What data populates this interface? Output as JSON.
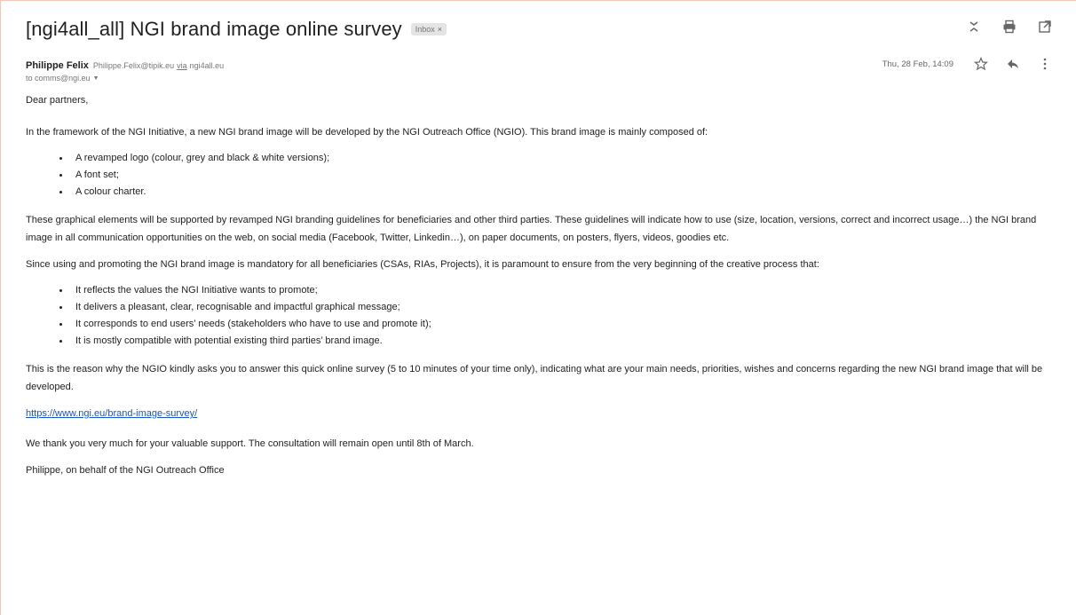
{
  "header": {
    "subject": "[ngi4all_all] NGI brand image online survey",
    "label": "Inbox",
    "label_close": "×",
    "icons": [
      "expand-collapse-icon",
      "print-icon",
      "open-in-new-window-icon"
    ]
  },
  "message": {
    "sender_name": "Philippe Felix",
    "sender_email": "Philippe.Felix@tipik.eu",
    "via": "via",
    "list_address": "ngi4all.eu",
    "date": "Thu, 28 Feb, 14:09",
    "to": "to comms@ngi.eu",
    "icons": [
      "star-icon",
      "reply-icon",
      "more-options-icon"
    ]
  },
  "body": {
    "greeting": "Dear partners,",
    "intro": "In the framework of the NGI Initiative, a new NGI brand image will be developed by the NGI Outreach Office (NGIO). This brand image is mainly composed of:",
    "components": [
      "A revamped logo (colour, grey and black & white versions);",
      "A font set;",
      "A colour charter."
    ],
    "guidelines": "These graphical elements will be supported by revamped NGI branding guidelines for beneficiaries and other third parties. These guidelines will indicate how to use (size, location, versions, correct and incorrect usage…) the NGI brand image in all communication opportunities on the web, on social media (Facebook, Twitter, Linkedin…), on paper documents, on posters, flyers, videos, goodies etc.",
    "mandatory": "Since using and promoting the NGI brand image is mandatory for all beneficiaries (CSAs, RIAs, Projects), it is paramount to ensure from the very beginning of the creative process that:",
    "requirements": [
      "It reflects the values the NGI Initiative wants to promote;",
      "It delivers a pleasant, clear, recognisable and impactful graphical message;",
      "It corresponds to end users’ needs (stakeholders who have to use and promote it);",
      "It is mostly compatible with potential existing third parties’ brand image."
    ],
    "reason": "This is the reason why the NGIO kindly asks you to answer this quick online survey (5 to 10 minutes of your time only), indicating what are your main needs, priorities, wishes and concerns regarding the new NGI brand image that will be developed.",
    "link": "https://www.ngi.eu/brand-image-survey/",
    "thanks": "We thank you very much for your valuable support. The consultation will remain open until 8th of March.",
    "signature": "Philippe, on behalf of the NGI Outreach Office"
  }
}
